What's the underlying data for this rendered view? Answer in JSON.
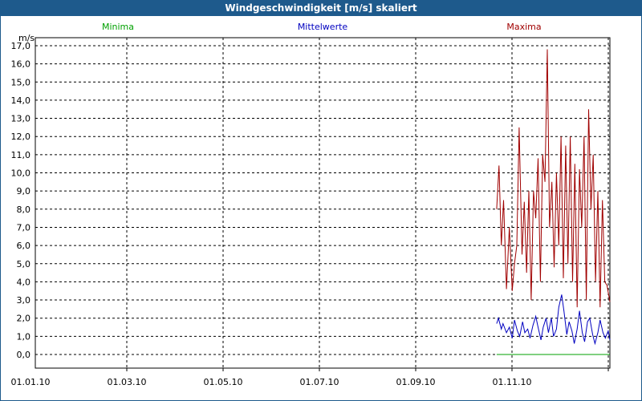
{
  "window": {
    "title": "Windgeschwindigkeit [m/s] skaliert"
  },
  "chart_data": {
    "type": "line",
    "title": "Windgeschwindigkeit [m/s] skaliert",
    "ylabel": "m/s",
    "xlabel": "",
    "ylim": [
      0,
      17
    ],
    "yticks": [
      "0,0",
      "1,0",
      "2,0",
      "3,0",
      "4,0",
      "5,0",
      "6,0",
      "7,0",
      "8,0",
      "9,0",
      "10,0",
      "11,0",
      "12,0",
      "13,0",
      "14,0",
      "15,0",
      "16,0",
      "17,0"
    ],
    "xticks": [
      "01.01.10",
      "01.03.10",
      "01.05.10",
      "01.07.10",
      "01.09.10",
      "01.11.10"
    ],
    "grid": true,
    "legend_placement": "top",
    "series": [
      {
        "name": "Minima",
        "color": "#00a000",
        "x": [
          0.803,
          1.0
        ],
        "values": [
          0.0,
          0.0
        ]
      },
      {
        "name": "Mittelwerte",
        "color": "#0000c0",
        "x": [
          0.803,
          0.806,
          0.811,
          0.814,
          0.82,
          0.825,
          0.83,
          0.834,
          0.839,
          0.843,
          0.848,
          0.852,
          0.857,
          0.861,
          0.866,
          0.871,
          0.875,
          0.88,
          0.884,
          0.889,
          0.893,
          0.898,
          0.902,
          0.907,
          0.911,
          0.916,
          0.92,
          0.925,
          0.929,
          0.934,
          0.938,
          0.943,
          0.947,
          0.952,
          0.956,
          0.961,
          0.965,
          0.97,
          0.974,
          0.979,
          0.983,
          0.988,
          0.992,
          0.997,
          1.0
        ],
        "values": [
          1.7,
          2.0,
          1.4,
          1.7,
          1.2,
          1.5,
          0.9,
          1.9,
          1.3,
          1.0,
          1.8,
          1.2,
          1.4,
          0.9,
          1.6,
          2.1,
          1.5,
          0.8,
          1.5,
          2.0,
          1.2,
          2.0,
          1.0,
          1.4,
          2.6,
          3.3,
          2.4,
          1.1,
          1.8,
          1.3,
          0.6,
          1.4,
          2.4,
          1.2,
          0.7,
          1.8,
          2.0,
          1.1,
          0.6,
          1.2,
          1.9,
          1.2,
          0.9,
          1.3,
          0.8
        ]
      },
      {
        "name": "Maxima",
        "color": "#a00000",
        "x": [
          0.803,
          0.807,
          0.811,
          0.815,
          0.82,
          0.825,
          0.83,
          0.834,
          0.838,
          0.842,
          0.847,
          0.851,
          0.855,
          0.859,
          0.863,
          0.867,
          0.871,
          0.875,
          0.879,
          0.883,
          0.887,
          0.891,
          0.895,
          0.899,
          0.903,
          0.907,
          0.911,
          0.915,
          0.919,
          0.923,
          0.927,
          0.931,
          0.935,
          0.939,
          0.943,
          0.947,
          0.951,
          0.955,
          0.959,
          0.963,
          0.967,
          0.971,
          0.975,
          0.979,
          0.983,
          0.987,
          0.991,
          0.995,
          1.0
        ],
        "values": [
          8.0,
          10.4,
          6.0,
          8.5,
          3.6,
          7.0,
          3.5,
          5.0,
          6.0,
          12.5,
          5.5,
          8.4,
          4.5,
          9.0,
          3.0,
          9.0,
          7.5,
          10.8,
          4.0,
          11.0,
          9.5,
          16.8,
          7.0,
          9.5,
          4.8,
          10.0,
          6.0,
          12.0,
          4.2,
          11.5,
          5.0,
          12.0,
          4.0,
          10.5,
          2.6,
          10.2,
          7.0,
          12.0,
          3.0,
          13.5,
          8.0,
          11.0,
          4.0,
          9.0,
          2.6,
          8.5,
          4.0,
          3.8,
          2.9
        ]
      }
    ]
  }
}
